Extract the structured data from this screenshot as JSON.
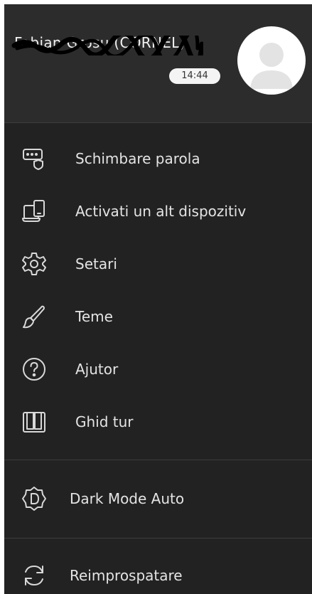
{
  "header": {
    "username": "Fabian Grosu ­(CORNEL)",
    "time": "14:44"
  },
  "menu": [
    {
      "label": "Schimbare parola",
      "icon": "password-shield-icon"
    },
    {
      "label": "Activati un alt dispozitiv",
      "icon": "devices-icon"
    },
    {
      "label": "Setari",
      "icon": "gear-icon"
    },
    {
      "label": "Teme",
      "icon": "paint-brush-icon"
    },
    {
      "label": "Ajutor",
      "icon": "help-circle-icon"
    },
    {
      "label": "Ghid tur",
      "icon": "book-icon"
    }
  ],
  "dark_mode": {
    "label": "Dark Mode Auto",
    "icon": "dark-mode-badge-icon"
  },
  "refresh": {
    "label": "Reimprospatare",
    "icon": "refresh-icon"
  },
  "colors": {
    "panel_bg": "#222222",
    "header_bg": "#2c2c2c",
    "text": "#e4e4e4",
    "icon_stroke": "#d8d8d8",
    "divider": "#3d3d3d"
  }
}
